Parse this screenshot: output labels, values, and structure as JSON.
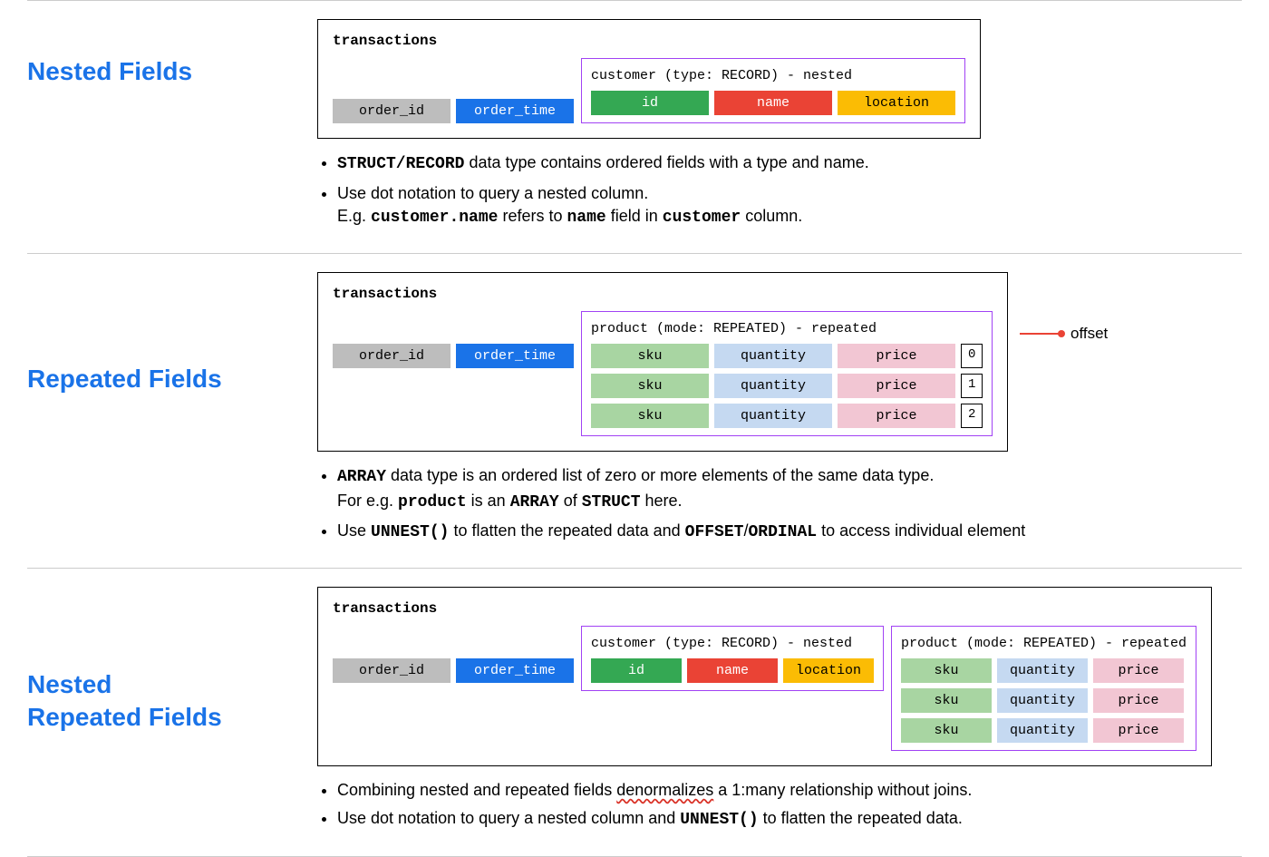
{
  "sections": {
    "nested": {
      "title": "Nested Fields",
      "diagram_title": "transactions",
      "base_cols": {
        "col0": "order_id",
        "col1": "order_time"
      },
      "group_label": "customer (type: RECORD) - nested",
      "group_cols": {
        "c0": "id",
        "c1": "name",
        "c2": "location"
      },
      "bullets": {
        "b1_front": "STRUCT/RECORD",
        "b1_rest": " data type contains ordered fields with a type and name.",
        "b2_line1": "Use dot notation to query a nested column.",
        "b2_eg": "E.g. ",
        "b2_code1": "customer.name",
        "b2_mid": " refers to ",
        "b2_code2": "name",
        "b2_mid2": " field in ",
        "b2_code3": "customer",
        "b2_end": " column."
      }
    },
    "repeated": {
      "title": "Repeated Fields",
      "diagram_title": "transactions",
      "base_cols": {
        "col0": "order_id",
        "col1": "order_time"
      },
      "group_label": "product (mode: REPEATED) - repeated",
      "cols": {
        "c0": "sku",
        "c1": "quantity",
        "c2": "price"
      },
      "offsets": {
        "o0": "0",
        "o1": "1",
        "o2": "2"
      },
      "offset_label": "offset",
      "bullets": {
        "b1_front": "ARRAY",
        "b1_rest": " data type is an ordered list of zero or more elements of the same data type.",
        "b1_eg": "For e.g. ",
        "b1_c1": "product",
        "b1_mid": " is an ",
        "b1_c2": "ARRAY",
        "b1_mid2": " of ",
        "b1_c3": "STRUCT",
        "b1_end": " here.",
        "b2_pre": "Use ",
        "b2_c1": "UNNEST()",
        "b2_mid": " to flatten the repeated data and ",
        "b2_c2": "OFFSET",
        "b2_slash": "/",
        "b2_c3": "ORDINAL",
        "b2_end": " to access individual element"
      }
    },
    "both": {
      "title_l1": "Nested",
      "title_l2": "Repeated Fields",
      "diagram_title": "transactions",
      "base_cols": {
        "col0": "order_id",
        "col1": "order_time"
      },
      "custgroup_label": "customer (type: RECORD) - nested",
      "cust_cols": {
        "c0": "id",
        "c1": "name",
        "c2": "location"
      },
      "prodgroup_label": "product (mode: REPEATED) - repeated",
      "prod_cols": {
        "c0": "sku",
        "c1": "quantity",
        "c2": "price"
      },
      "bullets": {
        "b1_pre": "Combining nested and repeated fields ",
        "b1_sq": "denormalizes",
        "b1_end": " a 1:many relationship without joins.",
        "b2_pre": "Use dot notation to query a nested column and ",
        "b2_c1": "UNNEST()",
        "b2_end": " to flatten the repeated data."
      }
    }
  }
}
